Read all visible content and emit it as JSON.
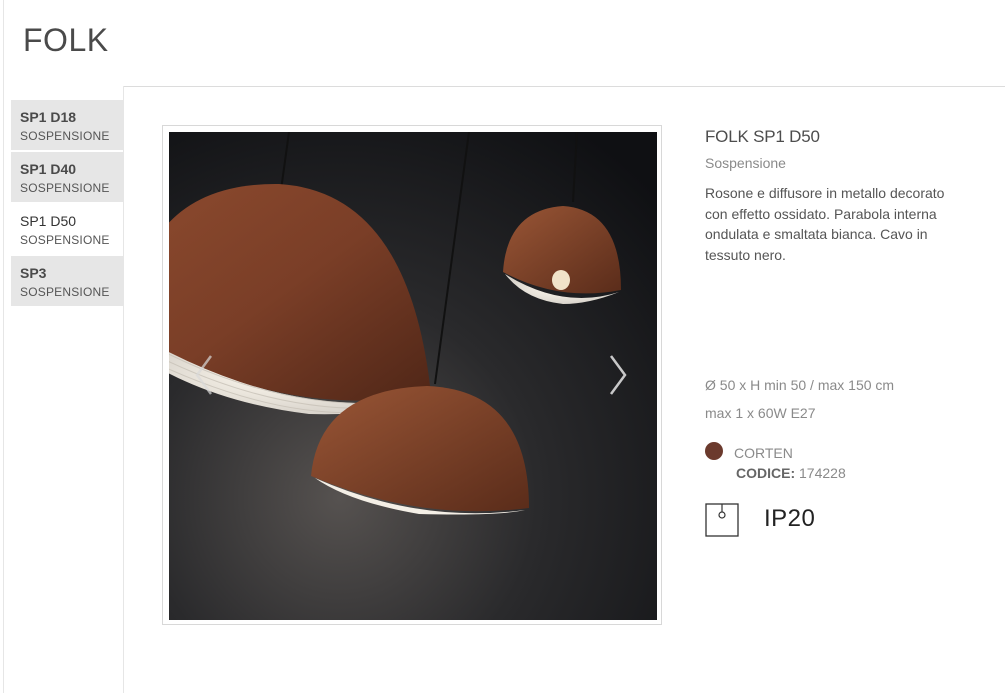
{
  "page": {
    "title": "FOLK"
  },
  "sidebar": {
    "items": [
      {
        "code": "SP1 D18",
        "type": "SOSPENSIONE",
        "active": false
      },
      {
        "code": "SP1 D40",
        "type": "SOSPENSIONE",
        "active": false
      },
      {
        "code": "SP1 D50",
        "type": "SOSPENSIONE",
        "active": true
      },
      {
        "code": "SP3",
        "type": "SOSPENSIONE",
        "active": false
      }
    ]
  },
  "gallery": {
    "image_alt": "FOLK SP1 D50",
    "prev_icon": "chevron-left-icon",
    "next_icon": "chevron-right-icon"
  },
  "product": {
    "title": "FOLK SP1 D50",
    "subtitle": "Sospensione",
    "description": "Rosone e diffusore in metallo decorato con effetto ossidato. Parabola interna ondulata e smaltata bianca. Cavo in tessuto nero.",
    "dimensions": "Ø 50 x H min 50 / max 150 cm",
    "power": "max 1 x 60W E27",
    "finish": {
      "name": "CORTEN",
      "color": "#6b3a2d"
    },
    "code_label": "CODICE:",
    "code_value": "174228",
    "ip_rating": "IP20",
    "ip_icon": "ip-rating-icon"
  },
  "colors": {
    "nav_bg": "#e6e6e6",
    "accent_brown": "#6b3a2d",
    "text_gray": "#8a8a8a"
  }
}
